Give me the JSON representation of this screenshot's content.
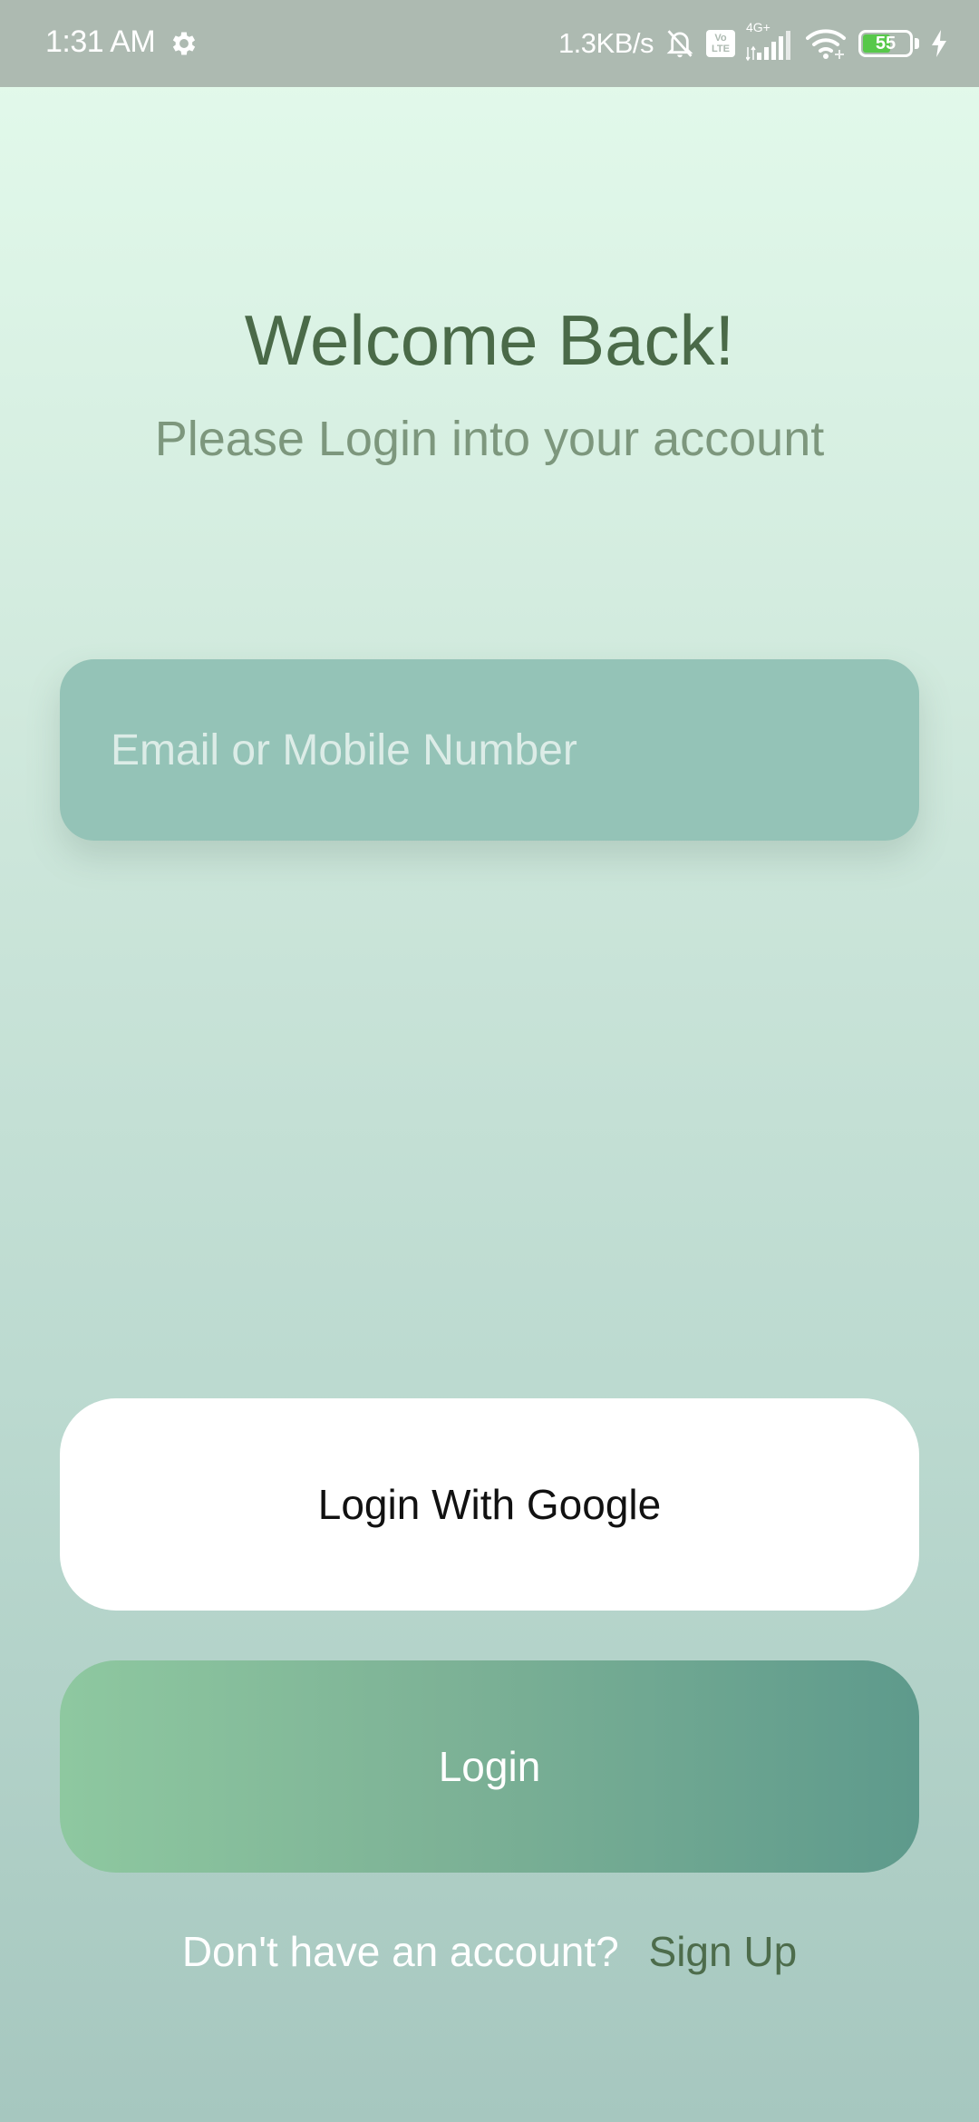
{
  "status_bar": {
    "time": "1:31 AM",
    "net_speed": "1.3KB/s",
    "network_type": "4G+",
    "volte_top": "Vo",
    "volte_bottom": "LTE",
    "battery_level": "55",
    "icons": [
      "settings-gear-icon",
      "mute-bell-icon",
      "volte-icon",
      "signal-icon",
      "wifi-icon",
      "battery-icon",
      "charging-bolt-icon"
    ]
  },
  "header": {
    "title": "Welcome Back!",
    "subtitle": "Please Login into your account"
  },
  "form": {
    "email_placeholder": "Email or Mobile Number",
    "email_value": ""
  },
  "actions": {
    "google_label": "Login With Google",
    "login_label": "Login"
  },
  "footer": {
    "prompt": "Don't have an account?",
    "signup_label": "Sign Up"
  },
  "colors": {
    "title": "#4a6a48",
    "subtitle": "#7d977d",
    "input_bg": "#94c3b7",
    "signup_link": "#4d6c4b",
    "battery_fill": "#57c84a"
  }
}
